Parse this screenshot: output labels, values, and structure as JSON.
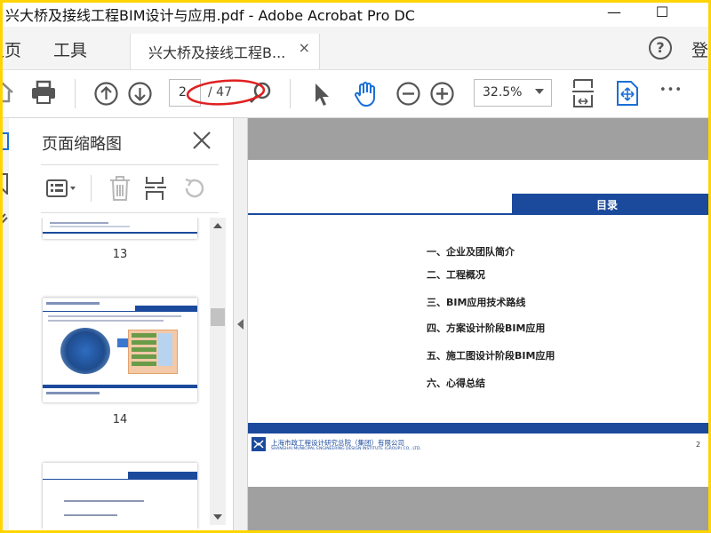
{
  "window": {
    "title": "兴大桥及接线工程BIM设计与应用.pdf - Adobe Acrobat Pro DC",
    "minimize_glyph": "—",
    "maximize_glyph": "☐"
  },
  "menu": {
    "home": "主页",
    "tools": "工具",
    "doc_tab_label": "兴大桥及接线工程B...",
    "doc_tab_close": "×",
    "help_glyph": "?",
    "login": "登"
  },
  "toolbar": {
    "page_current": "2",
    "page_total": "/ 47",
    "zoom": "32.5%",
    "more_glyph": "•••",
    "icons": [
      "home-icon",
      "print-icon",
      "previous-page-icon",
      "next-page-icon",
      "search-icon",
      "select-pointer-icon",
      "hand-tool-icon",
      "zoom-out-icon",
      "zoom-in-icon",
      "fit-page-icon",
      "scroll-mode-icon",
      "more-icon"
    ]
  },
  "panel": {
    "title": "页面缩略图",
    "close_glyph": "×",
    "tools": [
      "thumbnail-options-icon",
      "delete-page-icon",
      "insert-page-icon",
      "rotate-page-icon"
    ],
    "thumbnails": [
      {
        "number": "13"
      },
      {
        "number": "14"
      },
      {
        "number": ""
      }
    ]
  },
  "document": {
    "toc_title": "目录",
    "toc_items": [
      "一、企业及团队简介",
      "二、工程概况",
      "三、BIM应用技术路线",
      "四、方案设计阶段BIM应用",
      "五、施工图设计阶段BIM应用",
      "六、心得总结"
    ],
    "footer_company_cn": "上海市政工程设计研究总院（集团）有限公司",
    "footer_company_en": "SHANGHAI MUNICIPAL ENGINEERING DESIGN INSTITUTE (GROUP) CO., LTD.",
    "page_number": "2"
  },
  "colors": {
    "accent_blue": "#1b4a9c",
    "highlight_yellow": "#ffd400",
    "annotation_red": "#e02020",
    "viewer_gray": "#a0a0a0"
  }
}
